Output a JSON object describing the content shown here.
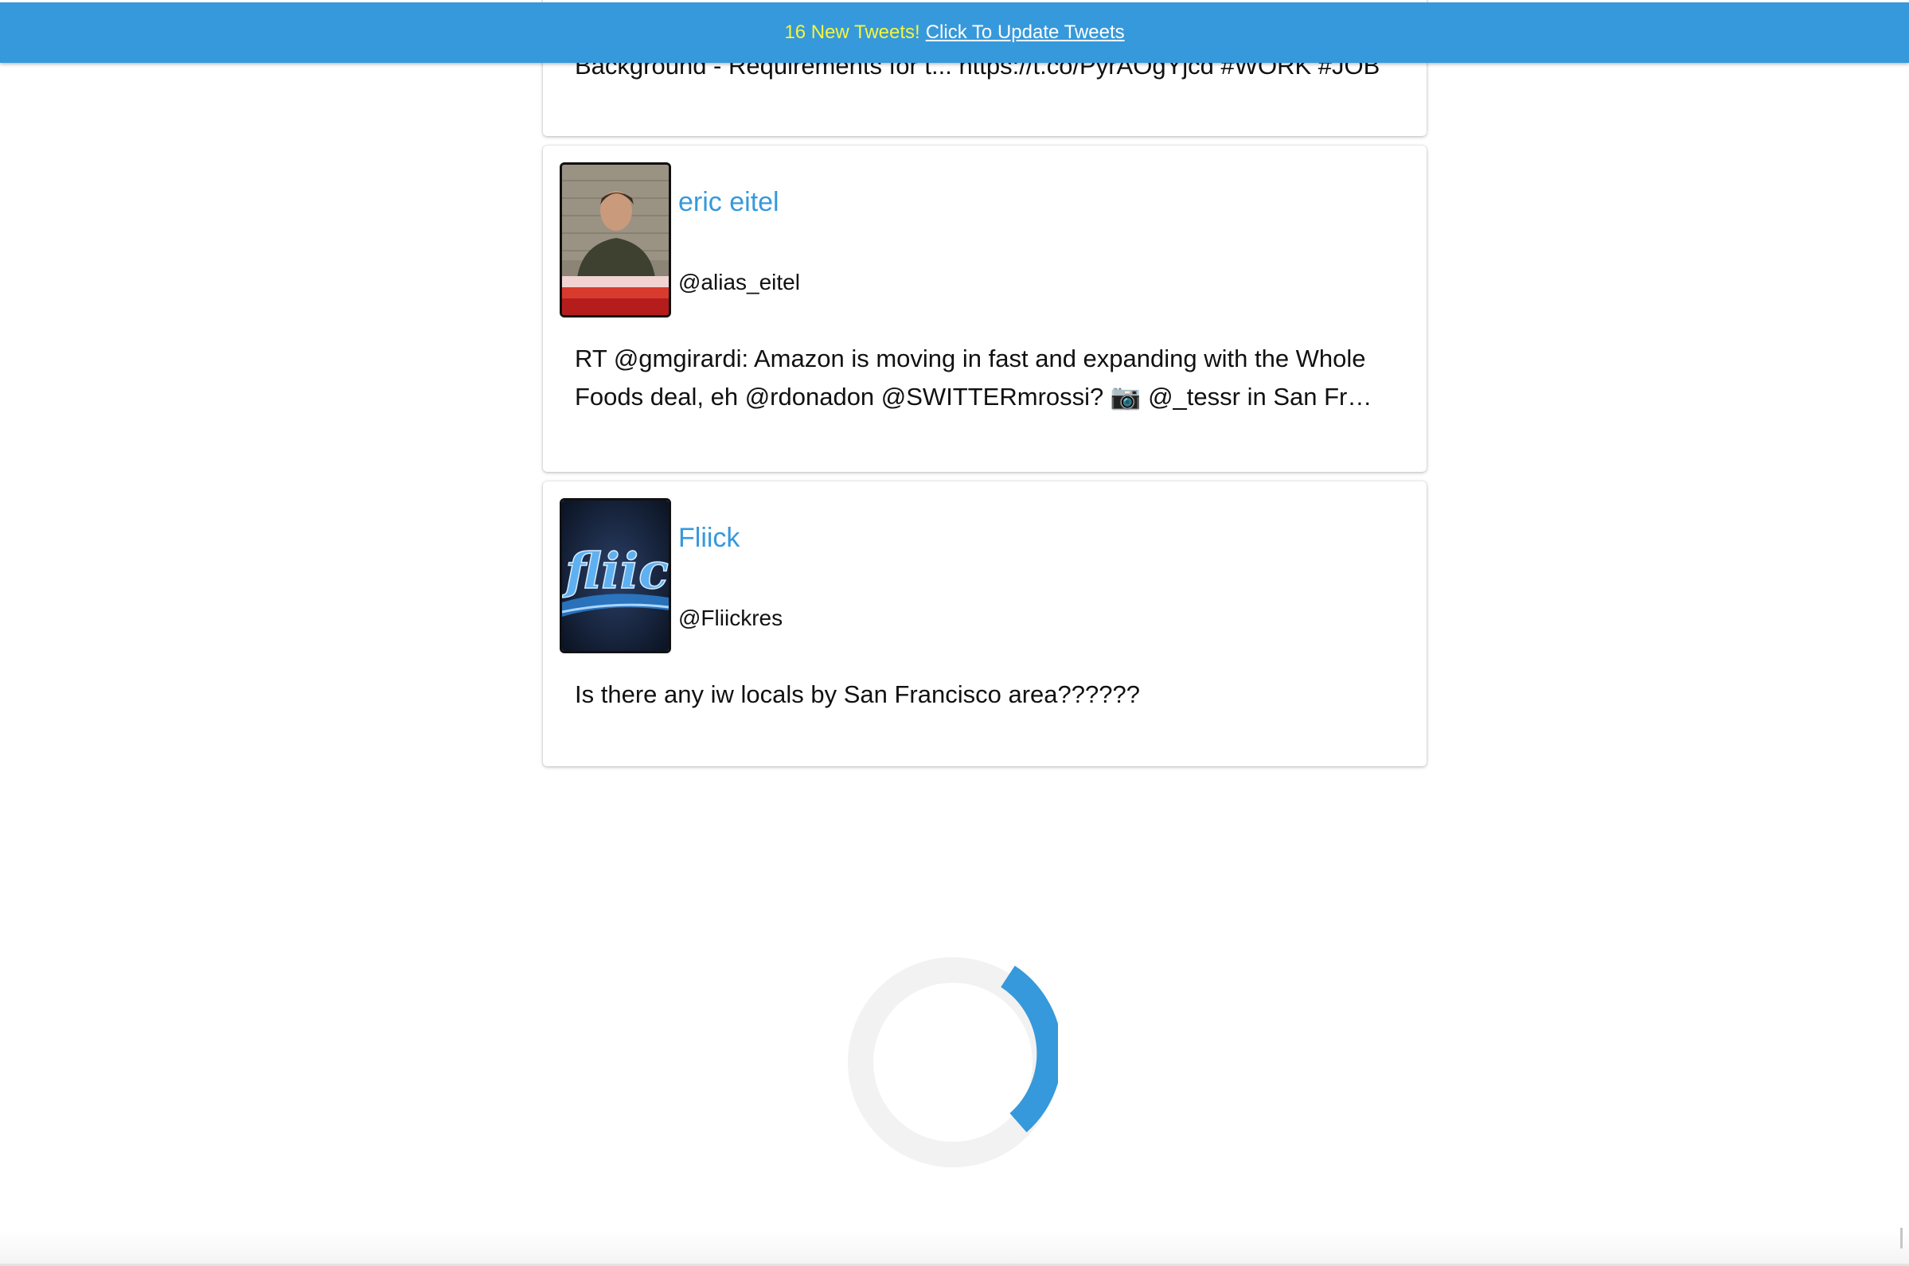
{
  "banner": {
    "new_count_text": "16 New Tweets!",
    "update_link": "Click To Update Tweets",
    "background_color": "#3699db",
    "count_color": "#f5f53a"
  },
  "tweets": [
    {
      "partial": true,
      "text": "Background - Requirements for t... https://t.co/PyrAOgYjcd #WORK #JOB"
    },
    {
      "display_name": "eric eitel",
      "handle": "@alias_eitel",
      "avatar_icon": "person-photo-avatar",
      "text": "RT @gmgirardi: Amazon is moving in fast and expanding with the Whole Foods deal, eh @rdonadon @SWITTERmrossi? 📷 @_tessr in San Fr…"
    },
    {
      "display_name": "Fliick",
      "handle": "@Fliickres",
      "avatar_icon": "fliick-logo-avatar",
      "text": "Is there any iw locals by San Francisco area??????"
    }
  ],
  "loader": {
    "icon": "loading-spinner",
    "track_color": "#f2f2f2",
    "arc_color": "#3699db"
  },
  "colors": {
    "accent": "#3699db",
    "text": "#111111",
    "background": "#ffffff"
  }
}
